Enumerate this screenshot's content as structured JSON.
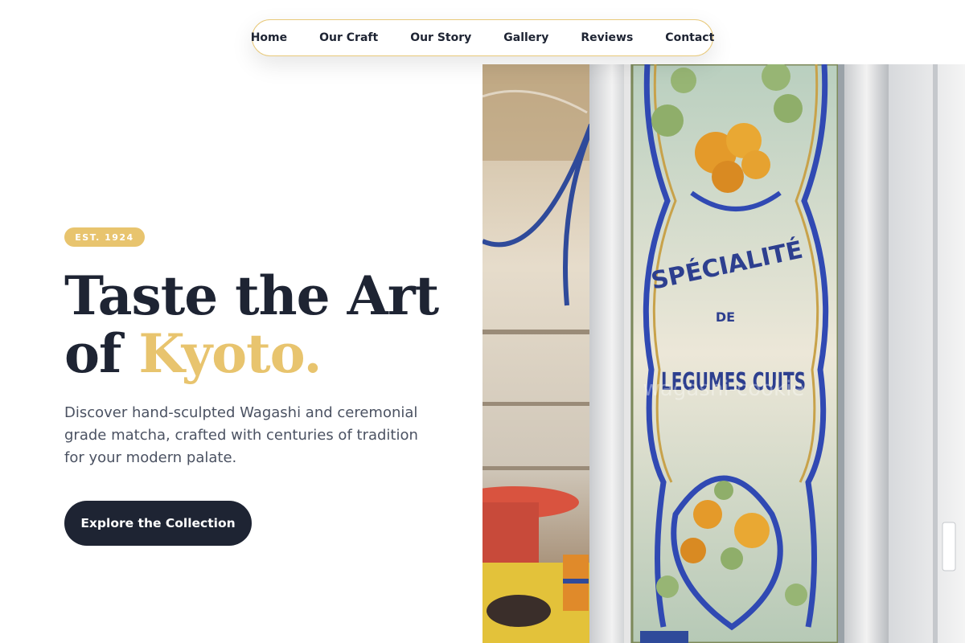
{
  "nav": {
    "items": [
      {
        "label": "Home"
      },
      {
        "label": "Our Craft"
      },
      {
        "label": "Our Story"
      },
      {
        "label": "Gallery"
      },
      {
        "label": "Reviews"
      },
      {
        "label": "Contact"
      }
    ]
  },
  "hero": {
    "badge": "EST. 1924",
    "headline_line1": "Taste the Art",
    "headline_line2_prefix": "of ",
    "headline_accent": "Kyoto.",
    "lead": "Discover hand-sculpted Wagashi and ceremonial grade matcha, crafted with centuries of tradition for your modern palate.",
    "cta_label": "Explore the Collection"
  },
  "photo": {
    "sign_line1": "SPÉCIALITÉ",
    "sign_line2": "DE",
    "sign_line3": "LEGUMES CUITS",
    "watermark": "wagashi-cookie"
  },
  "colors": {
    "accent": "#e8c46e",
    "navy": "#1e2433",
    "body_text": "#4b5262",
    "nav_border": "#e8c97a"
  }
}
